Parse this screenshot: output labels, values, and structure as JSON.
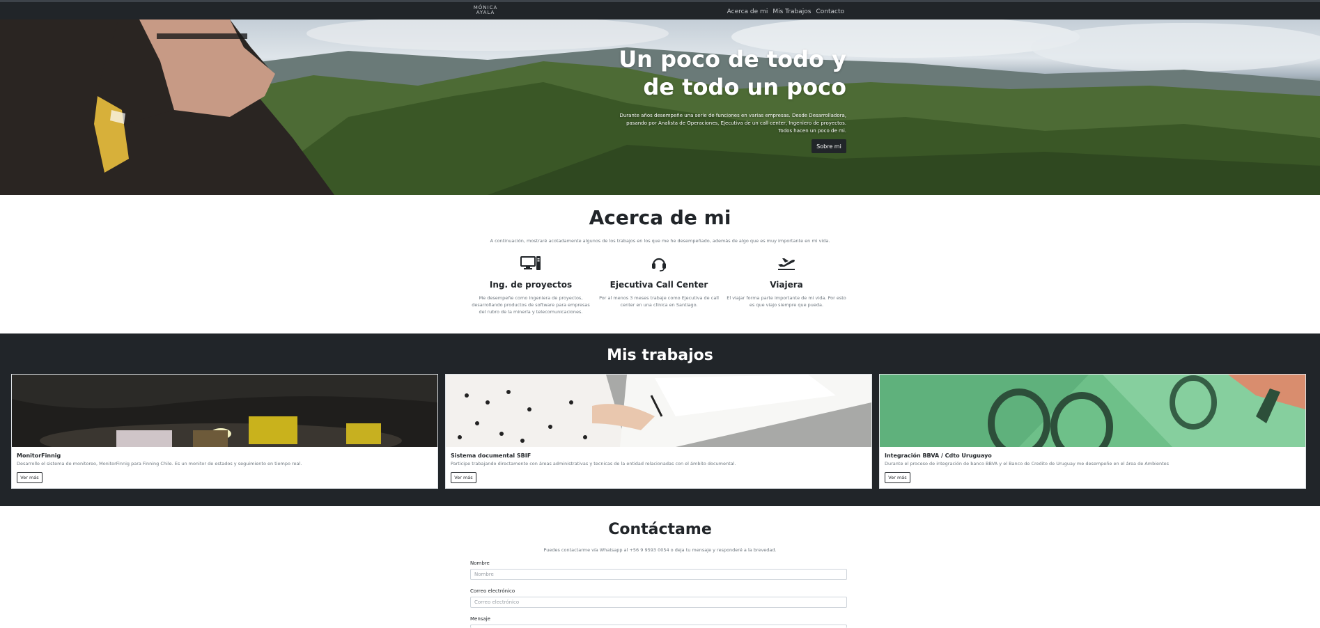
{
  "nav": {
    "logo_line1": "MÓNICA",
    "logo_line2": "AYALA",
    "links": [
      "Acerca de mi",
      "Mis Trabajos",
      "Contacto"
    ]
  },
  "hero": {
    "title_line1": "Un poco de todo y",
    "title_line2": "de todo un poco",
    "description": "Durante años desempeñe una serie de funciones en varias empresas. Desde Desarrolladora, pasando por Analista de Operaciones, Ejecutiva de un call center, Ingeniero de proyectos. Todos hacen un poco de mi.",
    "button_label": "Sobre mi"
  },
  "about": {
    "title": "Acerca de mi",
    "intro": "A continuación, mostraré acotadamente algunos de los trabajos en los que me he desempeñado, además de algo que es muy importante en mi vida.",
    "features": [
      {
        "icon": "desktop-icon",
        "title": "Ing. de proyectos",
        "text": "Me desempeñe como Ingeniera de proyectos, desarrollando productos de software para empresas del rubro de la minería y telecomunicaciones."
      },
      {
        "icon": "headset-icon",
        "title": "Ejecutiva Call Center",
        "text": "Por al menos 3 meses trabaje como Ejecutiva de call center en una clínica en Santiago."
      },
      {
        "icon": "plane-departure-icon",
        "title": "Viajera",
        "text": "El viajar forma parte importante de mi vida. Por esto es que viajo siempre que pueda."
      }
    ]
  },
  "works": {
    "title": "Mis trabajos",
    "cards": [
      {
        "title": "MonitorFinnig",
        "text": "Desarrolle el sistema de monitoreo, MonitorFinnig para Finning Chile. Es un monitor de estados y seguimiento en tiempo real.",
        "button": "Ver más"
      },
      {
        "title": "Sistema documental SBIF",
        "text": "Participe trabajando directamente con áreas administrativas y tecnicas de la entidad relacionadas con el ámbito documental.",
        "button": "Ver más"
      },
      {
        "title": "Integración BBVA / Cdto Uruguayo",
        "text": "Durante el proceso de integración de banco BBVA y el Banco de Credito de Uruguay me desempeñe en el área de Ambientes",
        "button": "Ver más"
      }
    ]
  },
  "contact": {
    "title": "Contáctame",
    "intro": "Puedes contactarme vía Whatsapp al +56 9 9593 0054 o deja tu mensaje y responderé a la brevedad.",
    "name_label": "Nombre",
    "name_placeholder": "Nombre",
    "email_label": "Correo electrónico",
    "email_placeholder": "Correo electrónico",
    "message_label": "Mensaje"
  },
  "colors": {
    "dark": "#212529",
    "muted": "#6c757d",
    "white": "#ffffff"
  }
}
